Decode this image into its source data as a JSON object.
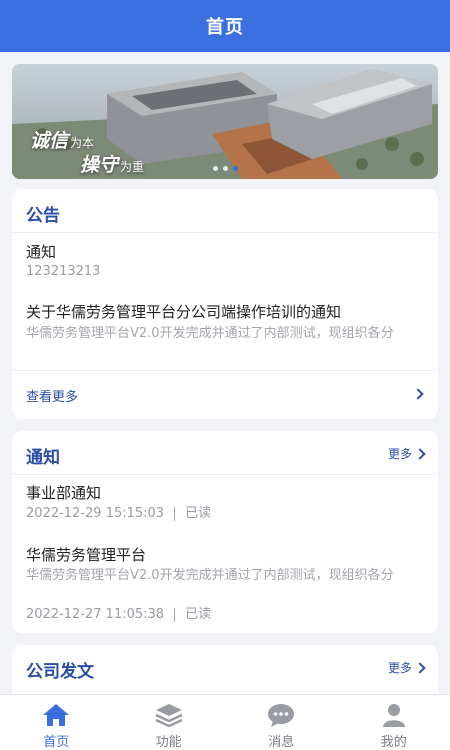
{
  "header": {
    "title": "首页"
  },
  "banner": {
    "slogan_line1_big": "诚信",
    "slogan_line1_small": "为本",
    "slogan_line2_big": "操守",
    "slogan_line2_small": "为重",
    "slide_count": 3,
    "active_slide": 3
  },
  "announcements": {
    "title": "公告",
    "items": [
      {
        "title": "通知",
        "subtitle": "123213213"
      },
      {
        "title": "关于华儒劳务管理平台分公司端操作培训的通知",
        "desc": "华儒劳务管理平台V2.0开发完成并通过了内部测试，现组织各分"
      }
    ],
    "view_more": "查看更多"
  },
  "notices": {
    "title": "通知",
    "more": "更多",
    "items": [
      {
        "title": "事业部通知",
        "time": "2022-12-29 15:15:03",
        "status": "已读"
      },
      {
        "title": "华儒劳务管理平台",
        "desc": "华儒劳务管理平台V2.0开发完成并通过了内部测试，现组织各分",
        "time": "2022-12-27 11:05:38",
        "status": "已读"
      }
    ]
  },
  "documents": {
    "title": "公司发文",
    "more": "更多"
  },
  "tabbar": {
    "items": [
      {
        "label": "首页",
        "icon": "home-icon",
        "active": true
      },
      {
        "label": "功能",
        "icon": "layers-icon",
        "active": false
      },
      {
        "label": "消息",
        "icon": "chat-icon",
        "active": false
      },
      {
        "label": "我的",
        "icon": "user-icon",
        "active": false
      }
    ]
  },
  "colors": {
    "primary": "#3b6fe0",
    "title_blue": "#2a4da6",
    "background": "#f2f3f7"
  }
}
